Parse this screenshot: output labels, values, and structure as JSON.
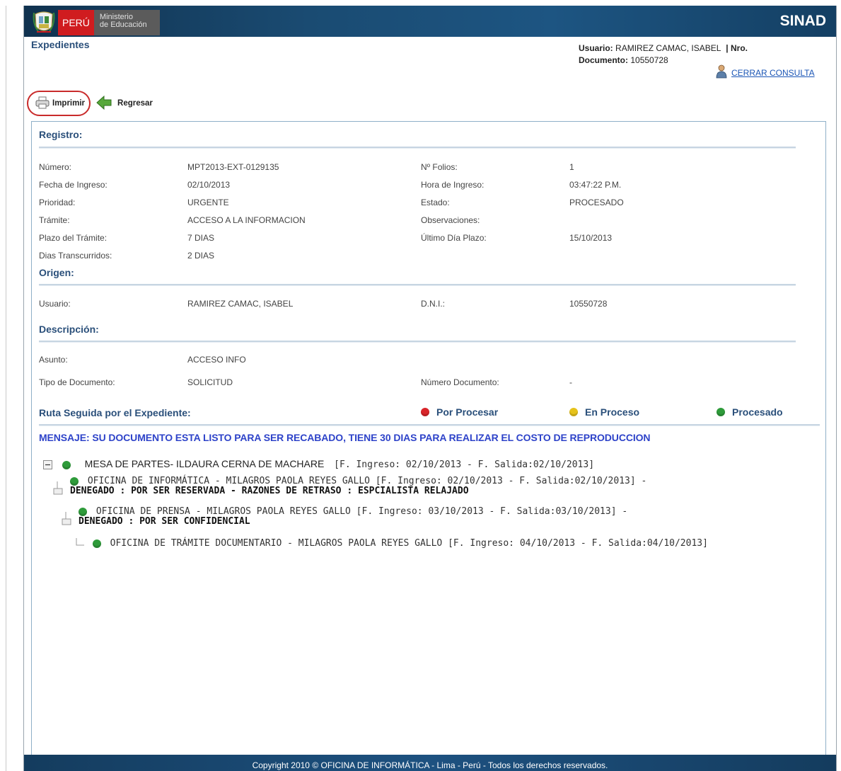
{
  "header": {
    "peru_label": "PERÚ",
    "ministry_line1": "Ministerio",
    "ministry_line2": "de Educación",
    "app_name": "SINAD"
  },
  "page_title": "Expedientes",
  "user_info": {
    "usuario_label": "Usuario:",
    "usuario_value": "RAMIREZ CAMAC, ISABEL",
    "nro_label": "| Nro.",
    "documento_label": "Documento:",
    "documento_value": "10550728",
    "logout_label": "CERRAR CONSULTA"
  },
  "toolbar": {
    "print_label": "Imprimir",
    "back_label": "Regresar"
  },
  "registro": {
    "title": "Registro:",
    "rows": [
      {
        "l1": "Número:",
        "v1": "MPT2013-EXT-0129135",
        "l2": "Nº Folios:",
        "v2": "1"
      },
      {
        "l1": "Fecha de Ingreso:",
        "v1": "02/10/2013",
        "l2": "Hora de Ingreso:",
        "v2": "03:47:22 P.M."
      },
      {
        "l1": "Prioridad:",
        "v1": "URGENTE",
        "l2": "Estado:",
        "v2": "PROCESADO"
      },
      {
        "l1": "Trámite:",
        "v1": "ACCESO A LA INFORMACION",
        "l2": "Observaciones:",
        "v2": ""
      },
      {
        "l1": "Plazo del Trámite:",
        "v1": "7 DIAS",
        "l2": "Último Día Plazo:",
        "v2": "15/10/2013"
      },
      {
        "l1": "Dias Transcurridos:",
        "v1": "2 DIAS",
        "l2": "",
        "v2": ""
      }
    ]
  },
  "origen": {
    "title": "Origen:",
    "usuario_label": "Usuario:",
    "usuario_value": "RAMIREZ CAMAC, ISABEL",
    "dni_label": "D.N.I.:",
    "dni_value": "10550728"
  },
  "descripcion": {
    "title": "Descripción:",
    "asunto_label": "Asunto:",
    "asunto_value": "ACCESO INFO",
    "tipo_label": "Tipo de Documento:",
    "tipo_value": "SOLICITUD",
    "numdoc_label": "Número Documento:",
    "numdoc_value": "-"
  },
  "ruta": {
    "title": "Ruta Seguida por el Expediente:",
    "legend": [
      {
        "label": "Por Procesar",
        "color": "#d9252a"
      },
      {
        "label": "En Proceso",
        "color": "#e6c21a"
      },
      {
        "label": "Procesado",
        "color": "#2e9b3a"
      }
    ]
  },
  "mensaje": "MENSAJE: SU DOCUMENTO ESTA LISTO PARA SER RECABADO, TIENE 30 DIAS PARA REALIZAR EL COSTO DE REPRODUCCION",
  "tree": {
    "n1_name": "MESA DE PARTES- ILDAURA CERNA DE MACHARE",
    "n1_dates": "[F. Ingreso: 02/10/2013 - F. Salida:02/10/2013]",
    "n2_text": "OFICINA DE INFORMÁTICA - MILAGROS PAOLA REYES GALLO [F. Ingreso: 02/10/2013 - F. Salida:02/10/2013] -",
    "n2_status": "DENEGADO : POR SER RESERVADA - RAZONES DE RETRASO : ESPCIALISTA RELAJADO",
    "n3_text": "OFICINA DE PRENSA - MILAGROS PAOLA REYES GALLO [F. Ingreso: 03/10/2013 - F. Salida:03/10/2013] -",
    "n3_status": "DENEGADO : POR SER CONFIDENCIAL",
    "n4_text": "OFICINA DE TRÁMITE DOCUMENTARIO - MILAGROS PAOLA REYES GALLO [F. Ingreso: 04/10/2013 - F. Salida:04/10/2013]"
  },
  "footer": "Copyright 2010 © OFICINA DE INFORMÁTICA - Lima - Perú - Todos los derechos reservados."
}
